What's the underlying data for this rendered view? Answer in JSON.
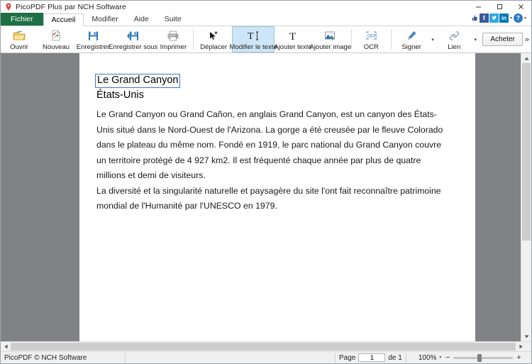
{
  "window": {
    "title": "PicoPDF Plus par NCH Software",
    "app_icon": "location-pin-icon",
    "minimize": "–",
    "maximize": "☐",
    "close": "✕"
  },
  "tabs": [
    {
      "label": "Fichier",
      "name": "tab-fichier",
      "active": false,
      "style": "file"
    },
    {
      "label": "Accueil",
      "name": "tab-accueil",
      "active": true,
      "style": "normal"
    },
    {
      "label": "Modifier",
      "name": "tab-modifier",
      "active": false,
      "style": "normal"
    },
    {
      "label": "Aide",
      "name": "tab-aide",
      "active": false,
      "style": "normal"
    },
    {
      "label": "Suite",
      "name": "tab-suite",
      "active": false,
      "style": "normal"
    }
  ],
  "social": {
    "like": "👍",
    "facebook": "f",
    "twitter": "🐦",
    "linkedin": "in",
    "help": "?",
    "caret": "▾"
  },
  "ribbon": {
    "items": [
      {
        "label": "Ouvrir",
        "icon": "open-folder-icon",
        "name": "ribbon-ouvrir"
      },
      {
        "label": "Nouveau",
        "icon": "new-document-icon",
        "name": "ribbon-nouveau"
      },
      {
        "label": "Enregistrer",
        "icon": "save-floppy-icon",
        "name": "ribbon-enregistrer"
      },
      {
        "label": "Enregistrer sous",
        "icon": "save-as-icon",
        "name": "ribbon-enregistrer-sous"
      },
      {
        "label": "Imprimer",
        "icon": "printer-icon",
        "name": "ribbon-imprimer"
      },
      {
        "label": "Déplacer",
        "icon": "move-cursor-icon",
        "name": "ribbon-deplacer"
      },
      {
        "label": "Modifier le texte",
        "icon": "edit-text-icon",
        "name": "ribbon-modifier-le-texte"
      },
      {
        "label": "Ajouter texte",
        "icon": "add-text-icon",
        "name": "ribbon-ajouter-texte"
      },
      {
        "label": "Ajouter image",
        "icon": "add-image-icon",
        "name": "ribbon-ajouter-image"
      },
      {
        "label": "OCR",
        "icon": "ocr-icon",
        "name": "ribbon-ocr"
      },
      {
        "label": "Signer",
        "icon": "pen-sign-icon",
        "name": "ribbon-signer"
      },
      {
        "label": "Lien",
        "icon": "link-paperclip-icon",
        "name": "ribbon-lien"
      }
    ],
    "active_item": "Modifier le texte",
    "buy_label": "Acheter",
    "overflow": "»",
    "caret": "▾"
  },
  "document": {
    "title": "Le Grand Canyon",
    "subtitle": "États-Unis",
    "paragraphs": [
      "Le Grand Canyon ou Grand Cañon, en anglais Grand Canyon, est un canyon des États-Unis situé dans le Nord-Ouest de l'Arizona. La gorge a été creusée par le fleuve Colorado dans le plateau du même nom. Fondé en 1919, le parc national du Grand Canyon couvre un territoire protégé de 4 927 km2. Il est fréquenté chaque année par plus de quatre millions et demi de visiteurs.",
      "La diversité et la singularité naturelle et paysagère du site l'ont fait reconnaître patrimoine mondial de l'Humanité par l'UNESCO en 1979."
    ],
    "selection_color": "#3a78c8"
  },
  "statusbar": {
    "copyright": "PicoPDF © NCH Software",
    "page_label": "Page",
    "page_value": "1",
    "page_of": "de 1",
    "zoom_value": "100%",
    "zoom_caret": "▾",
    "zoom_out": "−",
    "zoom_in": "+"
  },
  "scrollbars": {
    "up_arrow": "▲",
    "down_arrow": "▼",
    "left_arrow": "◀",
    "right_arrow": "▶"
  },
  "colors": {
    "file_tab_green": "#1d7044",
    "active_tool_blue": "#cde6f7",
    "workspace_gray": "#808285",
    "facebook": "#3b5998",
    "twitter": "#2fa8e0",
    "linkedin": "#0077b5"
  }
}
